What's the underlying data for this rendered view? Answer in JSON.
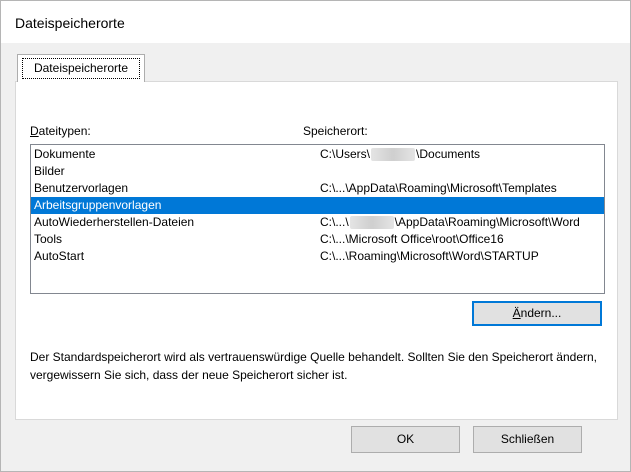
{
  "window": {
    "title": "Dateispeicherorte"
  },
  "tab": {
    "label": "Dateispeicherorte"
  },
  "labels": {
    "types_accel": "D",
    "types_rest": "ateitypen:",
    "location": "Speicherort:"
  },
  "rows": [
    {
      "type": "Dokumente",
      "loc_pre": "C:\\Users\\",
      "loc_post": "\\Documents",
      "redacted": true
    },
    {
      "type": "Bilder",
      "loc_pre": "",
      "loc_post": "",
      "redacted": false
    },
    {
      "type": "Benutzervorlagen",
      "loc_pre": "C:\\...\\AppData\\Roaming\\Microsoft\\Templates",
      "loc_post": "",
      "redacted": false
    },
    {
      "type": "Arbeitsgruppenvorlagen",
      "loc_pre": "",
      "loc_post": "",
      "redacted": false,
      "selected": true
    },
    {
      "type": "AutoWiederherstellen-Dateien",
      "loc_pre": "C:\\...\\",
      "loc_post": "\\AppData\\Roaming\\Microsoft\\Word",
      "redacted": true
    },
    {
      "type": "Tools",
      "loc_pre": "C:\\...\\Microsoft Office\\root\\Office16",
      "loc_post": "",
      "redacted": false
    },
    {
      "type": "AutoStart",
      "loc_pre": "C:\\...\\Roaming\\Microsoft\\Word\\STARTUP",
      "loc_post": "",
      "redacted": false
    }
  ],
  "change_button": {
    "accel": "Ä",
    "rest": "ndern..."
  },
  "description": "Der Standardspeicherort wird als vertrauenswürdige Quelle behandelt. Sollten Sie den Speicherort ändern, vergewissern Sie sich, dass der neue Speicherort sicher ist.",
  "footer": {
    "ok_label": "OK",
    "close_label": "Schließen"
  },
  "colors": {
    "selection": "#0078d7",
    "dialog_bg": "#f0f0f0",
    "default_button_border": "#0078d7"
  }
}
